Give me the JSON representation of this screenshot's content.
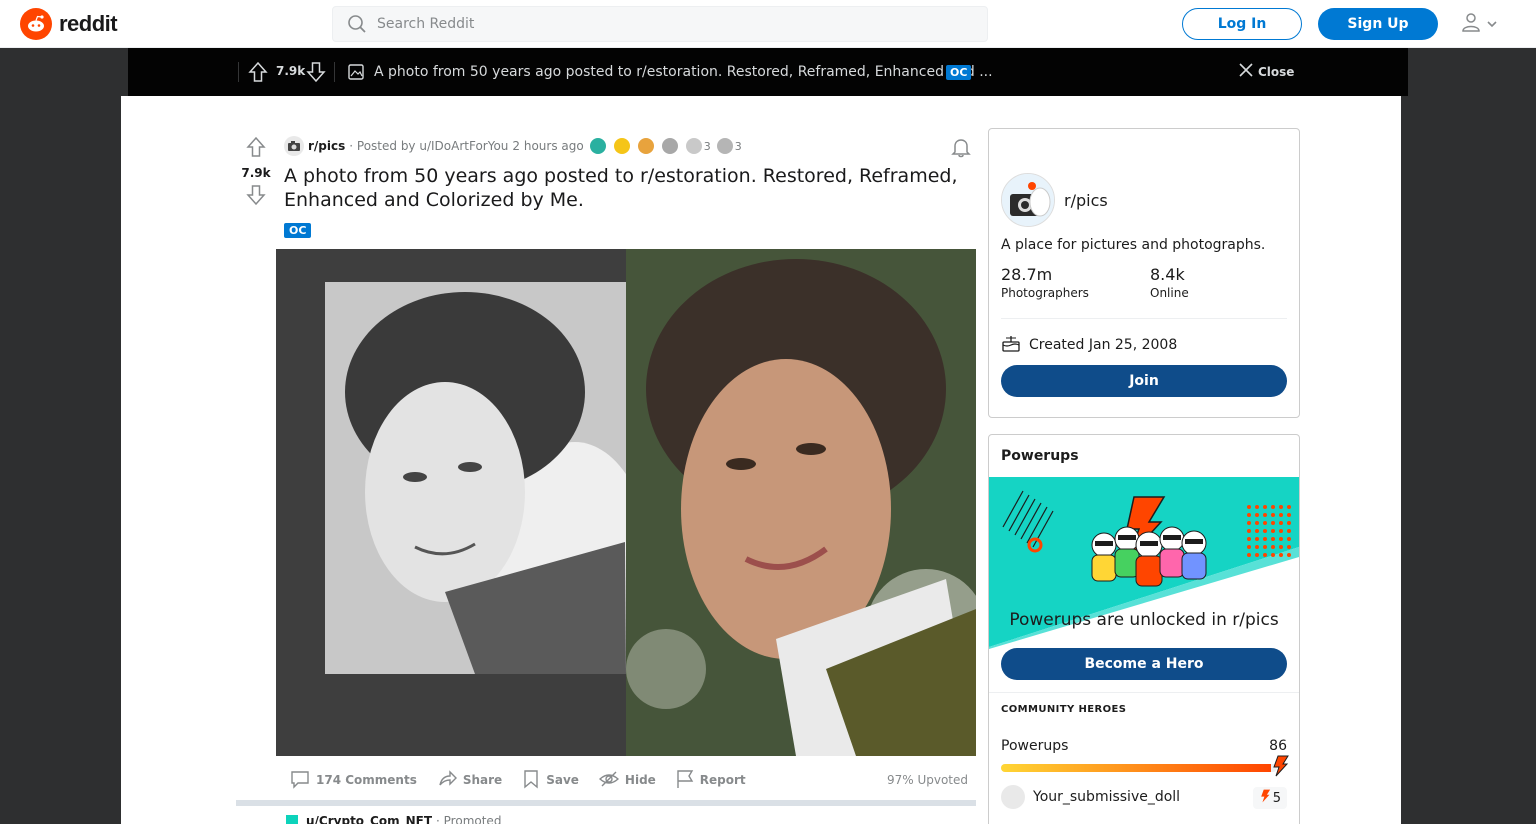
{
  "header": {
    "brand": "reddit",
    "search_placeholder": "Search Reddit",
    "login_label": "Log In",
    "signup_label": "Sign Up"
  },
  "post_bar": {
    "score": "7.9k",
    "title": "A photo from 50 years ago posted to r/estoration. Restored, Reframed, Enhanced and ...",
    "flair": "OC",
    "close_label": "Close"
  },
  "post": {
    "score": "7.9k",
    "subreddit": "r/pics",
    "posted_by": "· Posted by u/IDoArtForYou",
    "time": "2 hours ago",
    "award_counts": [
      "3",
      "3"
    ],
    "title": "A photo from 50 years ago posted to r/estoration. Restored, Reframed, Enhanced and Colorized by Me.",
    "flair": "OC",
    "actions": {
      "comments": "174 Comments",
      "share": "Share",
      "save": "Save",
      "hide": "Hide",
      "report": "Report"
    },
    "upvoted": "97% Upvoted"
  },
  "promoted": {
    "user": "u/Crypto_Com_NFT",
    "label": "· Promoted"
  },
  "sidebar": {
    "community": {
      "name": "r/pics",
      "description": "A place for pictures and photographs.",
      "members_value": "28.7m",
      "members_label": "Photographers",
      "online_value": "8.4k",
      "online_label": "Online",
      "created": "Created Jan 25, 2008",
      "join_label": "Join"
    },
    "powerups": {
      "header": "Powerups",
      "unlocked_text": "Powerups are unlocked in r/pics",
      "hero_button": "Become a Hero",
      "heroes_header": "COMMUNITY HEROES",
      "powerups_label": "Powerups",
      "powerups_count": "86",
      "progress_fraction": 0.98,
      "top_user": "Your_submissive_doll",
      "top_user_count": "5"
    }
  },
  "colors": {
    "brand_orange": "#ff4500",
    "link_blue": "#0079d3",
    "join_blue": "#0f4c8a",
    "page_dark": "#2e2f30"
  },
  "icons": [
    "reddit-logo-icon",
    "search-icon",
    "user-icon",
    "chevron-down-icon",
    "upvote-icon",
    "downvote-icon",
    "image-icon",
    "close-icon",
    "bell-icon",
    "comment-icon",
    "share-icon",
    "save-icon",
    "hide-icon",
    "report-icon",
    "cake-icon",
    "lightning-icon"
  ]
}
